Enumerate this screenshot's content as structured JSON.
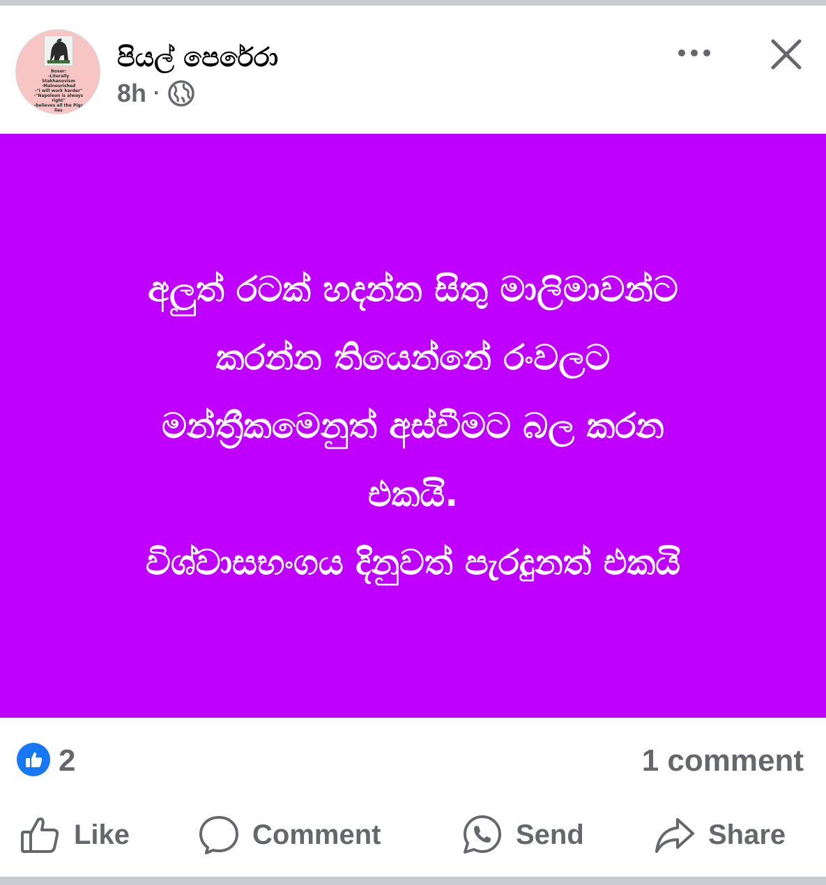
{
  "post": {
    "author": "පියල් පෙරේරා",
    "time": "8h",
    "separator": "·",
    "privacy_icon": "globe-icon",
    "avatar_text": [
      "Boxer:",
      "-Literally",
      "Stakhanovism",
      "-Malnourished",
      "-\"I will work harder\"",
      "-\"Napoleon is always",
      "right\"",
      "-believes all the Pigs",
      "lies"
    ],
    "background_color": "#c000ff",
    "lines": [
      "අලුත් රටක් හදන්න සිතු මාලිමාවන්ට",
      "කරන්න තියෙන්නේ රංවලට",
      "මන්ත්‍රීකමෙනුත් අස්වීමට බල කරන",
      "එකයි.",
      "විශ්වාසභංගය දිනුවත් පැරදුනත් එකයි"
    ]
  },
  "stats": {
    "likes": "2",
    "comments": "1 comment",
    "like_color": "#1877f2"
  },
  "actions": {
    "like": "Like",
    "comment": "Comment",
    "send": "Send",
    "share": "Share"
  }
}
